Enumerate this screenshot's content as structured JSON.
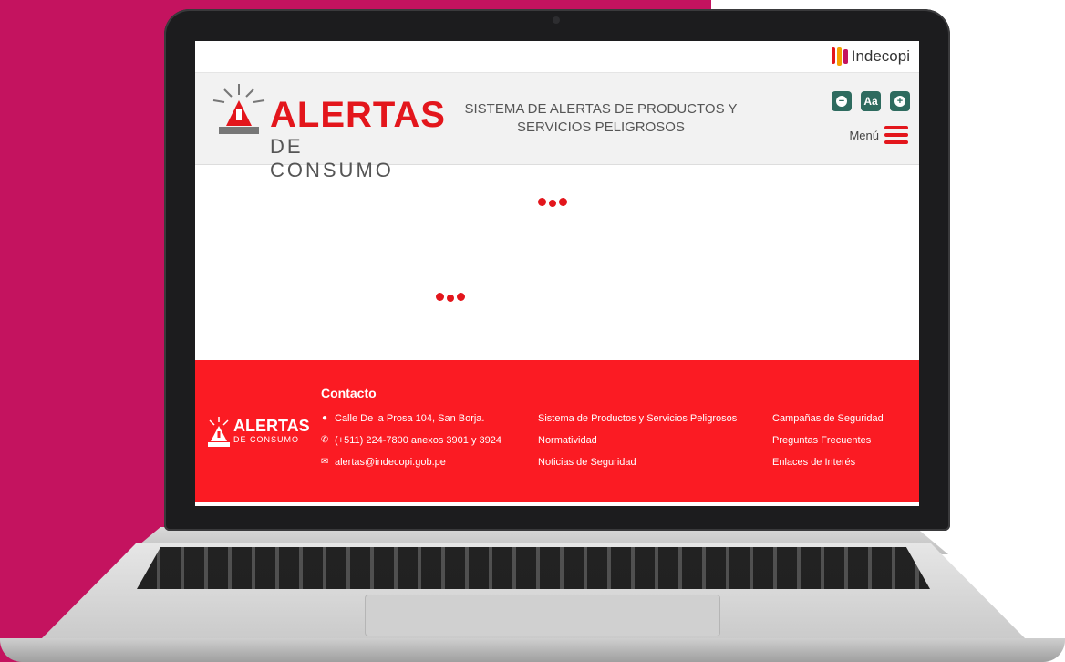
{
  "top_bar": {
    "brand": "Indecopi"
  },
  "header": {
    "logo_title": "ALERTAS",
    "logo_subtitle": "DE CONSUMO",
    "site_title_line1": "SISTEMA DE ALERTAS DE PRODUCTOS Y",
    "site_title_line2": "SERVICIOS PELIGROSOS",
    "font_controls": {
      "decrease": "−",
      "reset": "Aa",
      "increase": "+"
    },
    "menu_label": "Menú"
  },
  "footer": {
    "logo_title": "ALERTAS",
    "logo_subtitle": "DE CONSUMO",
    "contact_heading": "Contacto",
    "address": "Calle De la Prosa 104, San Borja.",
    "phone": "(+511) 224-7800 anexos 3901 y 3924",
    "email": "alertas@indecopi.gob.pe",
    "links_col1": [
      "Sistema de Productos y Servicios Peligrosos",
      "Normatividad",
      "Noticias de Seguridad"
    ],
    "links_col2": [
      "Campañas de Seguridad",
      "Preguntas Frecuentes",
      "Enlaces de Interés"
    ]
  },
  "colors": {
    "brand_red": "#e3161c",
    "footer_red": "#fb1b23",
    "magenta": "#c4135f",
    "button_green": "#2e6b5f"
  },
  "icons": [
    "indecopi-logo-icon",
    "siren-icon",
    "minus-icon",
    "plus-icon",
    "hamburger-icon",
    "location-pin-icon",
    "phone-icon",
    "envelope-icon",
    "loading-dots-icon"
  ]
}
